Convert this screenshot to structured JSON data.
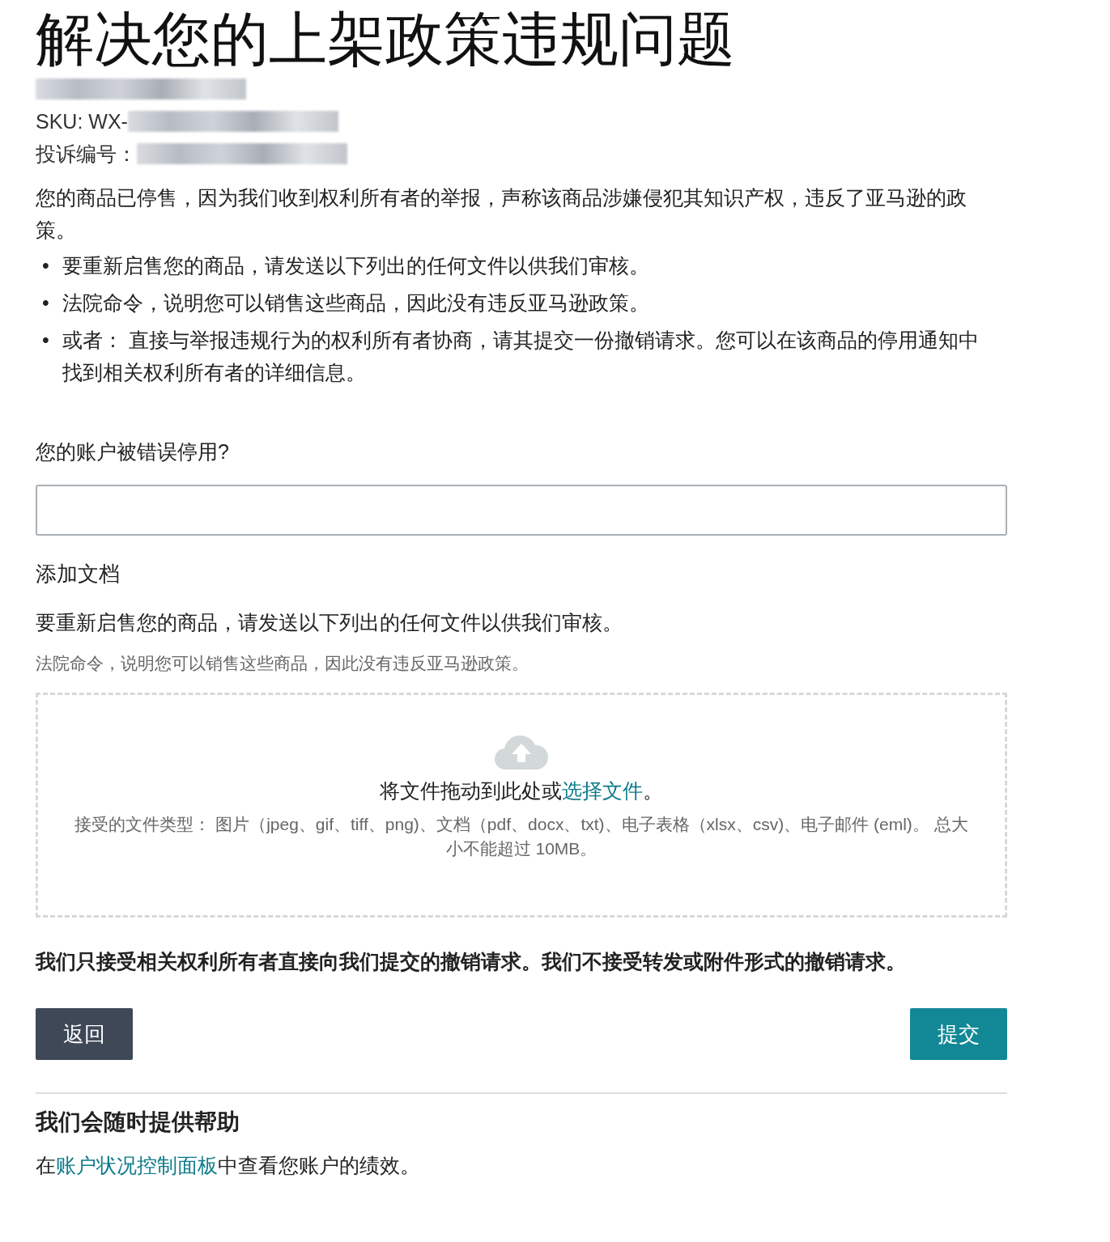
{
  "title": "解决您的上架政策违规问题",
  "info_lines": [
    {
      "redacted": true
    },
    {
      "label": "SKU: WX-",
      "redacted": true
    },
    {
      "label": "投诉编号：",
      "redacted": true
    }
  ],
  "intro": "您的商品已停售，因为我们收到权利所有者的举报，声称该商品涉嫌侵犯其知识产权，违反了亚马逊的政策。",
  "bullets": [
    {
      "marker": "•",
      "text": "要重新启售您的商品，请发送以下列出的任何文件以供我们审核。"
    },
    {
      "marker": "•",
      "text": "法院命令，说明您可以销售这些商品，因此没有违反亚马逊政策。"
    },
    {
      "marker": "•",
      "text": "或者： 直接与举报违规行为的权利所有者协商，请其提交一份撤销请求。您可以在该商品的停用通知中找到相关权利所有者的详细信息。"
    }
  ],
  "question": {
    "label": "您的账户被错误停用?"
  },
  "documents": {
    "heading": "添加文档",
    "instruction": "要重新启售您的商品，请发送以下列出的任何文件以供我们审核。",
    "hint": "法院命令，说明您可以销售这些商品，因此没有违反亚马逊政策。",
    "dropzone": {
      "prompt": "将文件拖动到此处或",
      "link": "选择文件",
      "prompt_end": "。",
      "accepted": "接受的文件类型： 图片（jpeg、gif、tiff、png)、文档（pdf、docx、txt)、电子表格（xlsx、csv)、电子邮件 (eml)。 总大小不能超过 10MB。"
    }
  },
  "notice": "我们只接受相关权利所有者直接向我们提交的撤销请求。我们不接受转发或附件形式的撤销请求。",
  "buttons": {
    "back": "返回",
    "submit": "提交"
  },
  "help": {
    "heading": "我们会随时提供帮助",
    "text_before": "在",
    "link": "账户状况控制面板",
    "text_after": "中查看您账户的绩效。"
  }
}
